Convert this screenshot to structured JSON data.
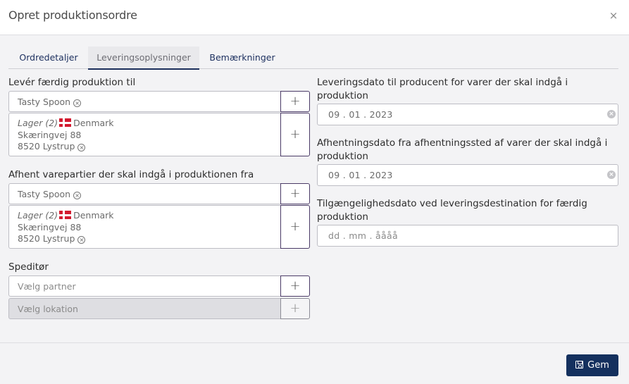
{
  "dialog": {
    "title": "Opret produktionsordre",
    "close_icon": "×"
  },
  "tabs": [
    {
      "label": "Ordredetaljer",
      "active": false
    },
    {
      "label": "Leveringsoplysninger",
      "active": true
    },
    {
      "label": "Bemærkninger",
      "active": false
    }
  ],
  "deliver_to": {
    "label": "Levér færdig produktion til",
    "partner": "Tasty Spoon",
    "location": {
      "name": "Lager (2)",
      "country": "Denmark",
      "street": "Skæringvej 88",
      "city": "8520 Lystrup"
    },
    "add_label": "+"
  },
  "pickup_from": {
    "label": "Afhent varepartier der skal indgå i produktionen fra",
    "partner": "Tasty Spoon",
    "location": {
      "name": "Lager (2)",
      "country": "Denmark",
      "street": "Skæringvej 88",
      "city": "8520 Lystrup"
    },
    "add_label": "+"
  },
  "forwarder": {
    "label": "Speditør",
    "partner_placeholder": "Vælg partner",
    "location_placeholder": "Vælg lokation",
    "add_label": "+"
  },
  "dates": [
    {
      "label": "Leveringsdato til producent for varer der skal indgå i produktion",
      "value": "09 . 01 . 2023",
      "placeholder": ""
    },
    {
      "label": "Afhentningsdato fra afhentningssted af varer der skal indgå i produktion",
      "value": "09 . 01 . 2023",
      "placeholder": ""
    },
    {
      "label": "Tilgængelighedsdato ved leveringsdestination for færdig produktion",
      "value": "",
      "placeholder": "dd . mm . åååå"
    }
  ],
  "clear_glyph": "×",
  "remove_glyph": "×",
  "footer": {
    "save_label": "Gem",
    "save_icon": "floppy-disk"
  },
  "colors": {
    "primary": "#14305e",
    "tab_active_border": "#1c2f5c",
    "add_button_border": "#4a3a66",
    "flag_red": "#d31a2f"
  }
}
